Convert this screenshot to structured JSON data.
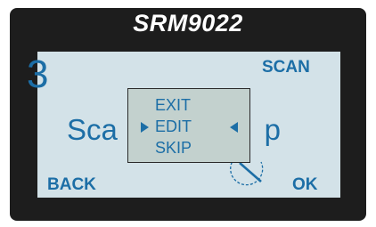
{
  "device": {
    "brand": "SRM9022"
  },
  "screen": {
    "step_number": "3",
    "step_title_left": "Sca",
    "step_title_right": "p",
    "scan_label": "SCAN",
    "back_label": "BACK",
    "ok_label": "OK"
  },
  "menu": {
    "items": [
      {
        "label": "EXIT",
        "selected": false
      },
      {
        "label": "EDIT",
        "selected": true
      },
      {
        "label": "SKIP",
        "selected": false
      }
    ]
  },
  "icons": {
    "selection_left": "triangle-right-icon",
    "selection_right": "triangle-left-icon",
    "dial": "dial-icon"
  },
  "colors": {
    "bezel": "#1d1d1d",
    "screen": "#d3e2e8",
    "text_accent": "#1c6ea6",
    "menu_background": "#c3d1ce"
  }
}
